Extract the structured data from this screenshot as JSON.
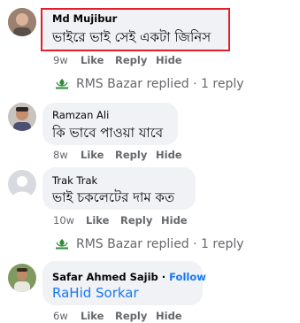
{
  "comments": [
    {
      "author": "Md Mujibur",
      "text": "ভাইরে ভাই সেই একটা জিনিস",
      "time": "9w",
      "like": "Like",
      "reply": "Reply",
      "hide": "Hide"
    },
    {
      "author": "Ramzan Ali",
      "text": "কি ভাবে পাওয়া যাবে",
      "time": "8w",
      "like": "Like",
      "reply": "Reply",
      "hide": "Hide"
    },
    {
      "author": "Trak Trak",
      "text": "ভাই চকলেটের দাম কত",
      "time": "10w",
      "like": "Like",
      "reply": "Reply",
      "hide": "Hide"
    },
    {
      "author": "Safar Ahmed Sajib",
      "separator": "·",
      "follow": "Follow",
      "text": "RaHid Sorkar",
      "time": "6w",
      "like": "Like",
      "reply": "Reply",
      "hide": "Hide"
    }
  ],
  "replies": [
    {
      "text": "RMS Bazar replied · 1 reply"
    },
    {
      "text": "RMS Bazar replied · 1 reply"
    }
  ],
  "colors": {
    "highlight": "#e41e26",
    "link": "#1877f2",
    "bubble": "#f0f2f5",
    "muted": "#65676b",
    "logo_green": "#2e8b3a"
  },
  "icons": {
    "page_logo": "rms-bazar-logo-icon",
    "default_avatar": "default-profile-icon"
  }
}
